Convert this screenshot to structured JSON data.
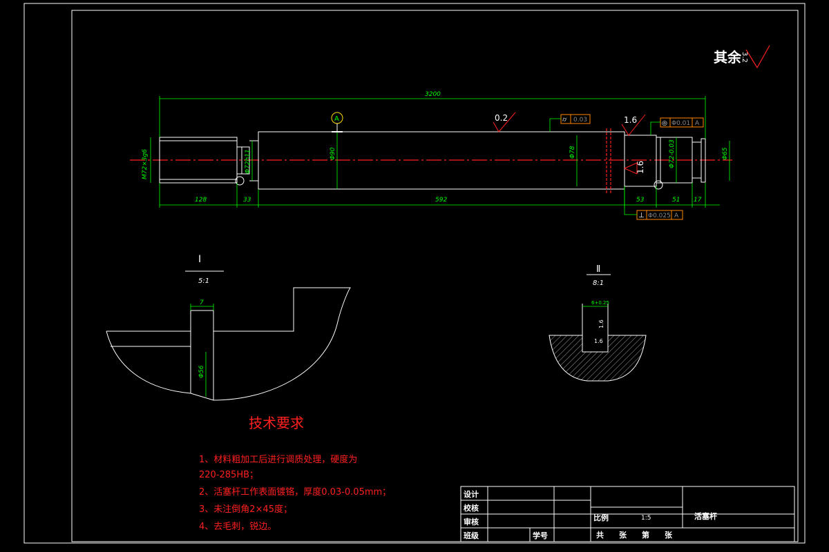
{
  "drawing": {
    "roughness_note": {
      "label": "其余",
      "value": "3.2"
    },
    "dimensions": {
      "overall": "3200",
      "thread": "M72×3g6",
      "dia_72h11": "Φ72h11",
      "dia_90": "Φ90",
      "dia_78": "Φ78",
      "dia_72_tol": "Φ72-0.03",
      "dia_65": "Φ65",
      "len_128": "128",
      "len_33": "33",
      "len_592": "592",
      "len_53": "53",
      "len_51": "51",
      "len_17": "17"
    },
    "roughness_marks": {
      "main": "0.2",
      "shoulder": "1.6",
      "vertical": "1.6"
    },
    "datum_label": "A",
    "tolerance_frames": [
      {
        "symbol": "⌭",
        "value": "0.03",
        "datum": ""
      },
      {
        "symbol": "◎",
        "value": "Φ0.01",
        "datum": "A"
      },
      {
        "symbol": "⊥",
        "value": "Φ0.025",
        "datum": "A"
      }
    ],
    "detail_1": {
      "label": "Ⅰ",
      "scale": "5:1",
      "width": "7",
      "dia": "Φ56"
    },
    "detail_2": {
      "label": "Ⅱ",
      "scale": "8:1",
      "width": "6+0.25",
      "rough_a": "1.6",
      "rough_b": "1.6"
    }
  },
  "tech_requirements": {
    "title": "技术要求",
    "items": [
      "1、材料粗加工后进行调质处理，硬度为",
      "220-285HB；",
      "2、活塞杆工作表面镀铬，厚度0.03-0.05mm；",
      "3、未注倒角2×45度；",
      "4、去毛刺，锐边。"
    ]
  },
  "title_block": {
    "design": "设计",
    "check": "校核",
    "review": "审核",
    "class": "班级",
    "student_id": "学号",
    "scale_label": "比例",
    "scale_value": "1:5",
    "part_name": "活塞杆",
    "sheets": "共　　张　　第　　张"
  },
  "colors": {
    "background": "#000000",
    "outline": "#ffffff",
    "dimension": "#00ff00",
    "centerline": "#ff2020"
  }
}
